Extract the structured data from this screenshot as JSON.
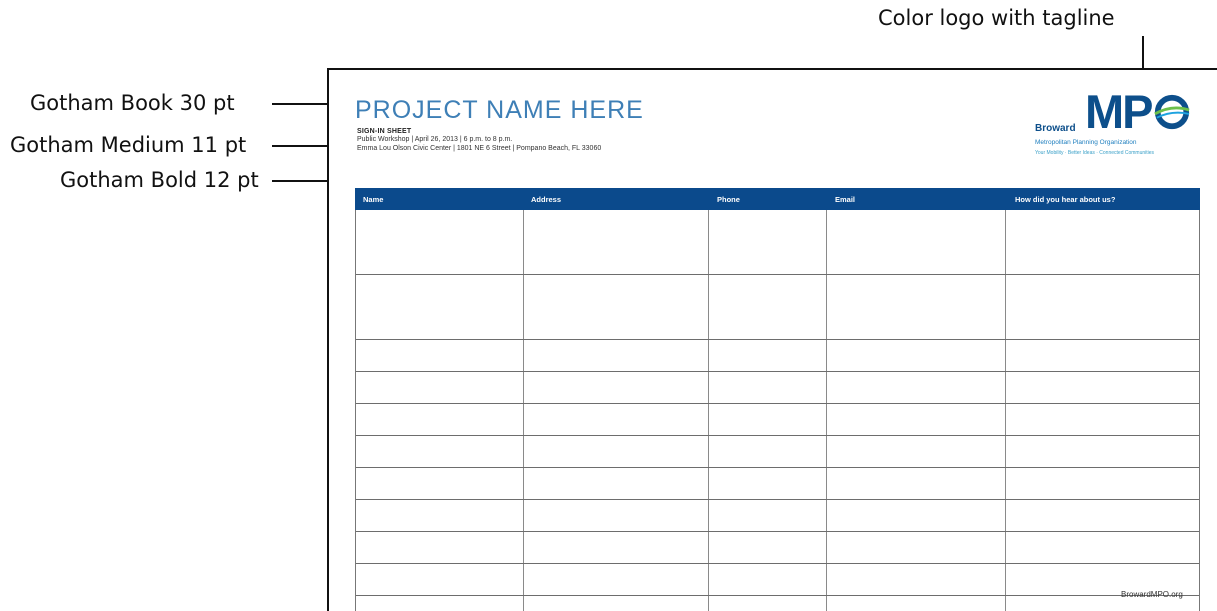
{
  "callouts": {
    "logo": "Color logo with tagline",
    "title_font": "Gotham Book 30 pt",
    "subtitle_font": "Gotham Medium 11 pt",
    "header_font": "Gotham Bold 12 pt"
  },
  "sheet": {
    "title": "PROJECT NAME HERE",
    "subtitle": "SIGN-IN SHEET",
    "event_line": "Public Workshop  |  April 26, 2013  |  6 p.m. to 8 p.m.",
    "location_line": "Emma Lou Olson Civic Center  |  1801 NE 6 Street  |  Pompano Beach, FL 33060",
    "logo": {
      "broward": "Broward",
      "mp": "MP",
      "org_name": "Metropolitan Planning Organization",
      "tagline": "Your Mobility · Better Ideas · Connected Communities",
      "color_primary": "#0d4f8b",
      "color_accent": "#1ea3e0",
      "color_green": "#6cc04a"
    },
    "table": {
      "columns": [
        "Name",
        "Address",
        "Phone",
        "Email",
        "How did you hear about us?"
      ],
      "row_count": 11
    },
    "footer_url": "BrowardMPO.org",
    "header_color": "#0b4a8c",
    "bar_color": "#1ea3e0"
  }
}
